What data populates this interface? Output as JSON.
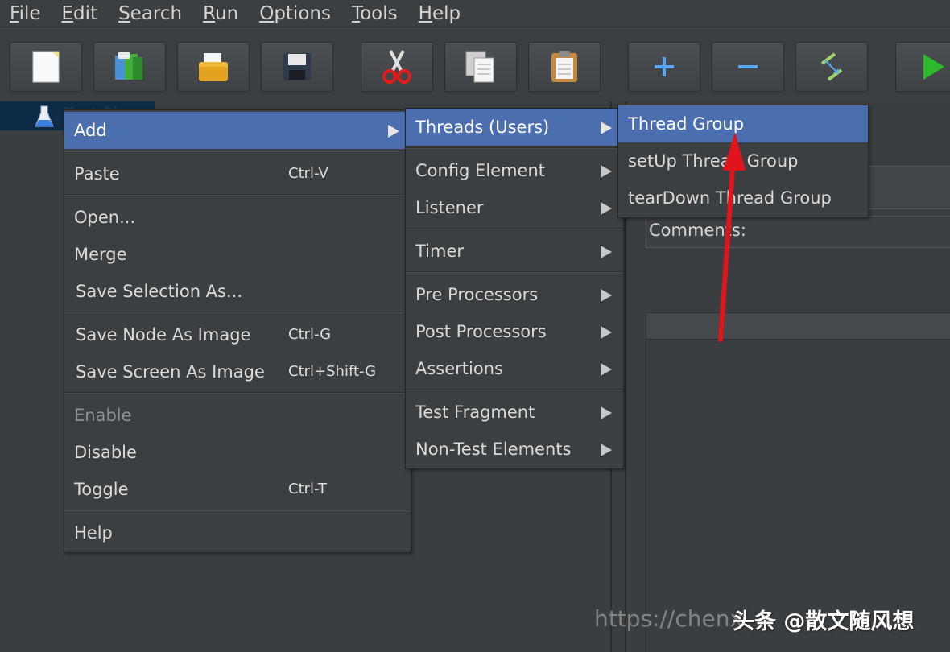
{
  "menubar": {
    "items": [
      {
        "mnemonic": "F",
        "rest": "ile"
      },
      {
        "mnemonic": "E",
        "rest": "dit"
      },
      {
        "mnemonic": "S",
        "rest": "earch"
      },
      {
        "mnemonic": "R",
        "rest": "un"
      },
      {
        "mnemonic": "O",
        "rest": "ptions"
      },
      {
        "mnemonic": "T",
        "rest": "ools"
      },
      {
        "mnemonic": "H",
        "rest": "elp"
      }
    ]
  },
  "toolbar": {
    "buttons": [
      "new-icon",
      "templates-icon",
      "open-icon",
      "save-icon",
      "cut-icon",
      "copy-icon",
      "paste-icon",
      "expand-icon",
      "collapse-icon",
      "toggle-icon",
      "start-icon"
    ]
  },
  "tree": {
    "node_label": "Test Plan"
  },
  "editor": {
    "comments_label": "Comments:"
  },
  "context_menu": {
    "add": "Add",
    "paste": "Paste",
    "paste_shortcut": "Ctrl-V",
    "open": "Open...",
    "merge": "Merge",
    "save_selection": "Save Selection As...",
    "save_node_image": "Save Node As Image",
    "save_node_image_shortcut": "Ctrl-G",
    "save_screen_image": "Save Screen As Image",
    "save_screen_image_shortcut": "Ctrl+Shift-G",
    "enable": "Enable",
    "disable": "Disable",
    "toggle": "Toggle",
    "toggle_shortcut": "Ctrl-T",
    "help": "Help"
  },
  "add_submenu": {
    "threads": "Threads (Users)",
    "config_element": "Config Element",
    "listener": "Listener",
    "timer": "Timer",
    "pre_processors": "Pre Processors",
    "post_processors": "Post Processors",
    "assertions": "Assertions",
    "test_fragment": "Test Fragment",
    "non_test_elements": "Non-Test Elements"
  },
  "threads_submenu": {
    "thread_group": "Thread Group",
    "setup_thread_group": "setUp Thread Group",
    "teardown_thread_group": "tearDown Thread Group"
  },
  "watermark": {
    "url": "https://chenx",
    "brand": "头条 @散文随风想"
  },
  "colors": {
    "selection": "#4b6eaf",
    "annotation_arrow": "#e0141a"
  }
}
